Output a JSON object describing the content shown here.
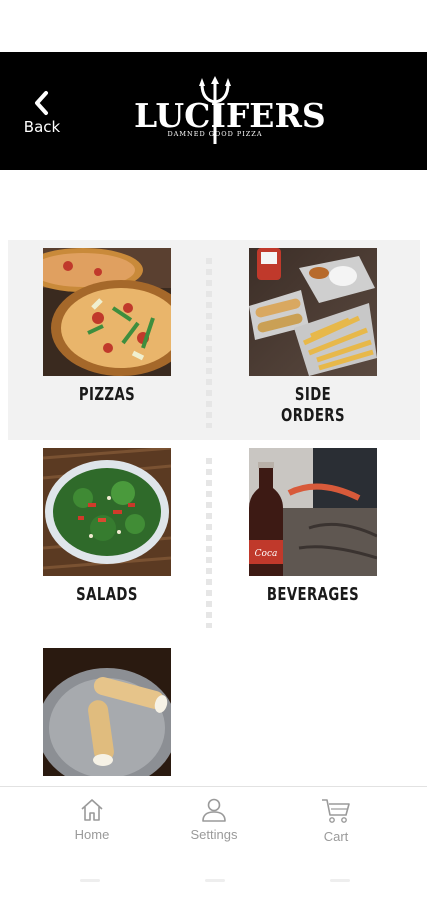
{
  "header": {
    "back_label": "Back",
    "logo_text": "LUCIFERS",
    "logo_tagline": "DAMNED GOOD PIZZA",
    "background": "#000000"
  },
  "categories": [
    {
      "label": "PIZZAS",
      "image": "pizza-photo"
    },
    {
      "label": "SIDE ORDERS",
      "image": "side-orders-photo"
    },
    {
      "label": "SALADS",
      "image": "salad-photo"
    },
    {
      "label": "BEVERAGES",
      "image": "beverages-photo"
    },
    {
      "label": "",
      "image": "cannoli-photo"
    }
  ],
  "tabbar": {
    "items": [
      {
        "label": "Home",
        "icon": "home-icon"
      },
      {
        "label": "Settings",
        "icon": "user-icon"
      },
      {
        "label": "Cart",
        "icon": "cart-icon"
      }
    ]
  },
  "colors": {
    "row_shade": "#f2f2f2",
    "tab_text": "#9a9a9a"
  }
}
